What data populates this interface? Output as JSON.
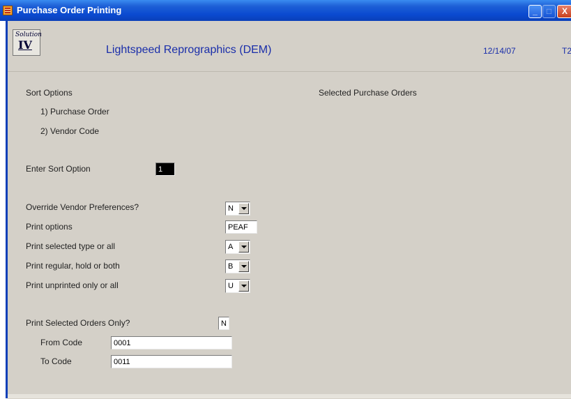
{
  "window": {
    "title": "Purchase Order Printing",
    "buttons": {
      "minimize": "_",
      "maximize": "□",
      "close": "X"
    }
  },
  "header": {
    "logo_line1": "Solution",
    "logo_line2": "IV",
    "company": "Lightspeed Reprographics (DEM)",
    "date": "12/14/07",
    "terminal": "T2"
  },
  "sort": {
    "heading": "Sort Options",
    "option1": "1) Purchase Order",
    "option2": "2) Vendor Code",
    "enter_label": "Enter Sort Option",
    "enter_value": "1"
  },
  "selected_heading": "Selected Purchase Orders",
  "options": {
    "override_label": "Override Vendor Preferences?",
    "override_value": "N",
    "print_options_label": "Print options",
    "print_options_value": "PEAF",
    "selected_type_label": "Print selected type or all",
    "selected_type_value": "A",
    "regular_hold_label": "Print regular, hold or both",
    "regular_hold_value": "B",
    "unprinted_label": "Print unprinted only or all",
    "unprinted_value": "U"
  },
  "selected_orders": {
    "label": "Print Selected Orders Only?",
    "value": "N",
    "from_label": "From Code",
    "from_value": "0001",
    "to_label": "To Code",
    "to_value": "0011"
  },
  "colors": {
    "titlebar": "#0a4ad0",
    "panel": "#d4d0c8",
    "accent_text": "#1a2eaa"
  }
}
